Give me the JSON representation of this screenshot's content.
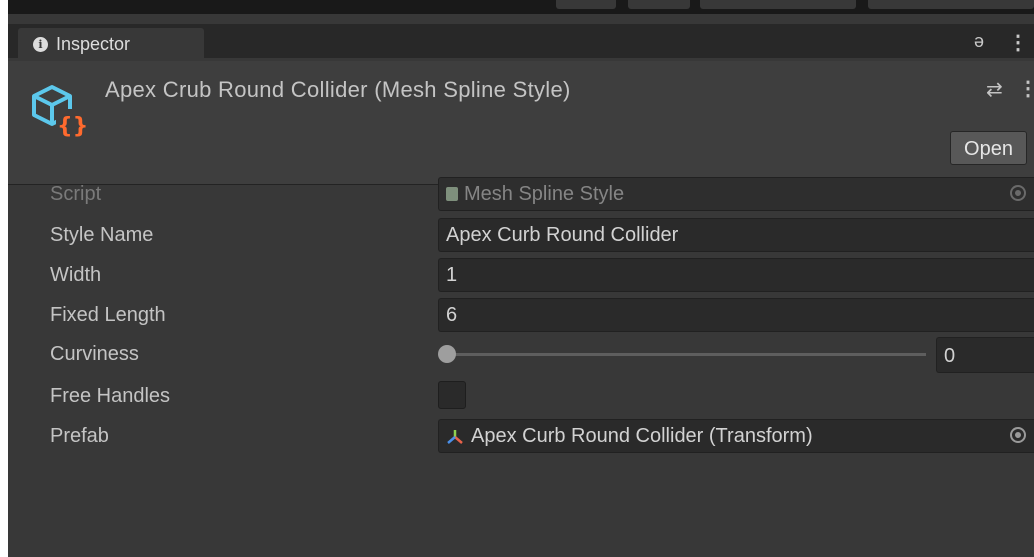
{
  "tab": {
    "label": "Inspector",
    "icon": "info-icon"
  },
  "header": {
    "title": "Apex Crub Round Collider (Mesh Spline Style)",
    "icon": "scriptable-object-icon",
    "open_label": "Open"
  },
  "properties": {
    "script": {
      "label": "Script",
      "value": "Mesh Spline Style"
    },
    "style_name": {
      "label": "Style Name",
      "value": "Apex Curb Round Collider"
    },
    "width": {
      "label": "Width",
      "value": "1"
    },
    "fixed_length": {
      "label": "Fixed Length",
      "value": "6"
    },
    "curviness": {
      "label": "Curviness",
      "value": "0",
      "level": 0
    },
    "free_handles": {
      "label": "Free Handles",
      "checked": false
    },
    "prefab": {
      "label": "Prefab",
      "value": "Apex Curb Round Collider (Transform)"
    }
  },
  "colors": {
    "background": "#383838",
    "header_background": "#3e3e3e",
    "field_background": "#2a2a2a",
    "asset_icon": "#5cc8ec",
    "asset_braces": "#ff6a2e"
  }
}
